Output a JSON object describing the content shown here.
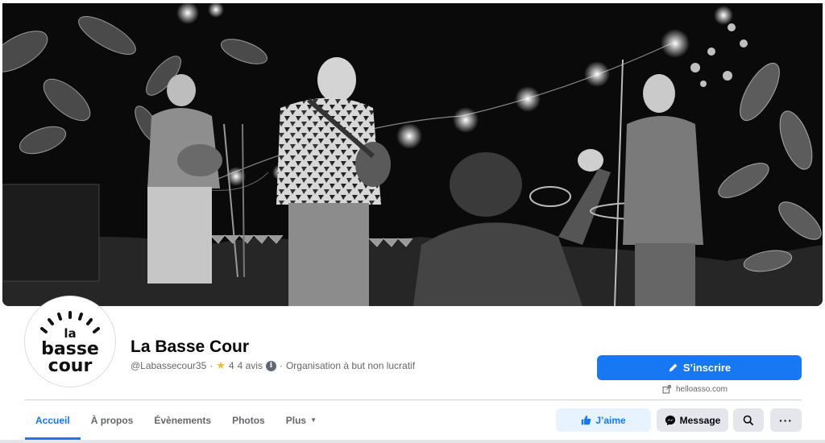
{
  "page": {
    "name": "La Basse Cour",
    "handle": "@Labassecour35",
    "rating_value": "4",
    "reviews_label": "4 avis",
    "category": "Organisation à but non lucratif",
    "separator": "·"
  },
  "logo": {
    "line1": "la",
    "line2": "basse",
    "line3": "cour"
  },
  "cta": {
    "label": "S’inscrire",
    "link_text": "helloasso.com"
  },
  "tabs": [
    {
      "label": "Accueil",
      "active": true
    },
    {
      "label": "À propos",
      "active": false
    },
    {
      "label": "Évènements",
      "active": false
    },
    {
      "label": "Photos",
      "active": false
    },
    {
      "label": "Plus",
      "active": false
    }
  ],
  "actions": {
    "like_label": "J’aime",
    "message_label": "Message",
    "more_label": "···"
  },
  "icons": {
    "star": "star-icon",
    "info": "info-icon",
    "pencil": "pencil-icon",
    "external_link": "external-link-icon",
    "thumbs_up": "thumbs-up-icon",
    "messenger": "messenger-icon",
    "search": "search-icon",
    "caret": "caret-down-icon"
  },
  "colors": {
    "accent": "#1877f2",
    "accent_light": "#e7f3ff",
    "button_gray": "#e4e6eb",
    "secondary_text": "#65676b",
    "star": "#f7b928"
  }
}
